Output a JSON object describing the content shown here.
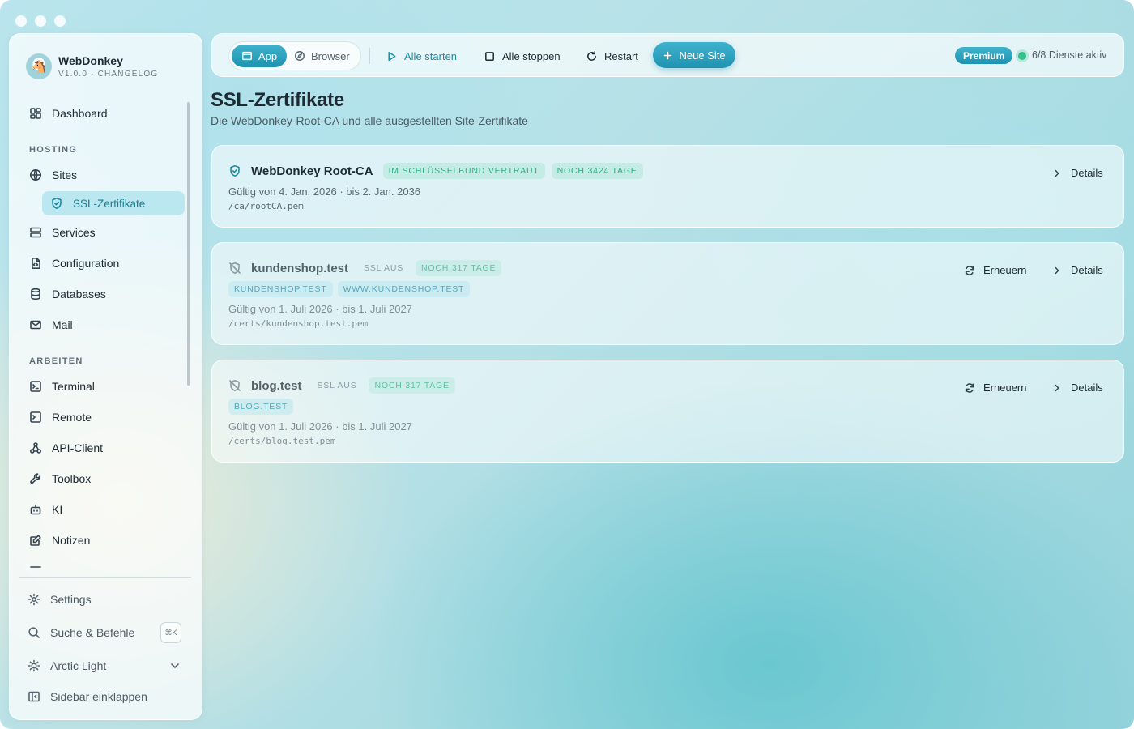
{
  "app": {
    "name": "WebDonkey",
    "version_line": "V1.0.0 · CHANGELOG"
  },
  "sidebar": {
    "dashboard": "Dashboard",
    "section_hosting": "HOSTING",
    "sites": "Sites",
    "ssl": "SSL-Zertifikate",
    "services": "Services",
    "configuration": "Configuration",
    "databases": "Databases",
    "mail": "Mail",
    "section_arbeiten": "ARBEITEN",
    "terminal": "Terminal",
    "remote": "Remote",
    "api_client": "API-Client",
    "toolbox": "Toolbox",
    "ki": "KI",
    "notizen": "Notizen",
    "settings": "Settings",
    "search": "Suche & Befehle",
    "search_shortcut": "⌘K",
    "theme": "Arctic Light",
    "collapse": "Sidebar einklappen"
  },
  "toolbar": {
    "app": "App",
    "browser": "Browser",
    "start_all": "Alle starten",
    "stop_all": "Alle stoppen",
    "restart": "Restart",
    "new_site": "Neue Site",
    "premium": "Premium",
    "status": "6/8 Dienste aktiv"
  },
  "page": {
    "title": "SSL-Zertifikate",
    "subtitle": "Die WebDonkey-Root-CA und alle ausgestellten Site-Zertifikate"
  },
  "root_ca": {
    "name": "WebDonkey Root-CA",
    "tag_trusted": "IM SCHLÜSSELBUND VERTRAUT",
    "tag_days": "NOCH 3424 TAGE",
    "valid": "Gültig von 4. Jan. 2026 · bis 2. Jan. 2036",
    "path": "/ca/rootCA.pem",
    "details": "Details"
  },
  "certs": [
    {
      "name": "kundenshop.test",
      "ssl": "SSL AUS",
      "days": "NOCH 317 TAGE",
      "domains": [
        "KUNDENSHOP.TEST",
        "WWW.KUNDENSHOP.TEST"
      ],
      "valid": "Gültig von 1. Juli 2026 · bis 1. Juli 2027",
      "path": "/certs/kundenshop.test.pem",
      "renew": "Erneuern",
      "details": "Details"
    },
    {
      "name": "blog.test",
      "ssl": "SSL AUS",
      "days": "NOCH 317 TAGE",
      "domains": [
        "BLOG.TEST"
      ],
      "valid": "Gültig von 1. Juli 2026 · bis 1. Juli 2027",
      "path": "/certs/blog.test.pem",
      "renew": "Erneuern",
      "details": "Details"
    }
  ]
}
